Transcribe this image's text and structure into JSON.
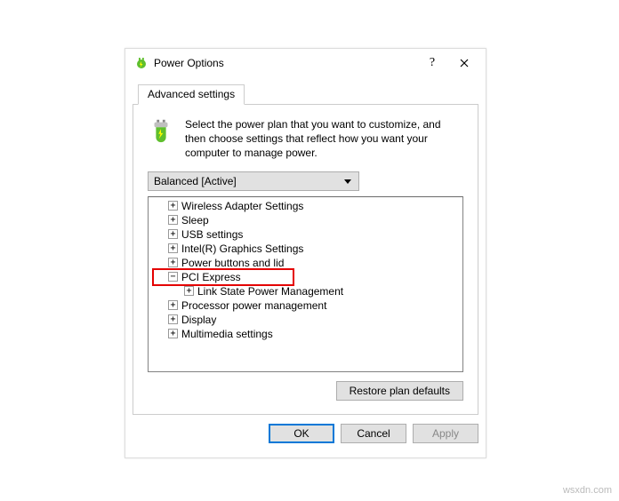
{
  "title": "Power Options",
  "tab": "Advanced settings",
  "description": "Select the power plan that you want to customize, and then choose settings that reflect how you want your computer to manage power.",
  "plan": "Balanced [Active]",
  "tree": [
    {
      "label": "Wireless Adapter Settings",
      "state": "plus",
      "level": 1
    },
    {
      "label": "Sleep",
      "state": "plus",
      "level": 1
    },
    {
      "label": "USB settings",
      "state": "plus",
      "level": 1
    },
    {
      "label": "Intel(R) Graphics Settings",
      "state": "plus",
      "level": 1
    },
    {
      "label": "Power buttons and lid",
      "state": "plus",
      "level": 1
    },
    {
      "label": "PCI Express",
      "state": "minus",
      "level": 1
    },
    {
      "label": "Link State Power Management",
      "state": "plus",
      "level": 2
    },
    {
      "label": "Processor power management",
      "state": "plus",
      "level": 1
    },
    {
      "label": "Display",
      "state": "plus",
      "level": 1
    },
    {
      "label": "Multimedia settings",
      "state": "plus",
      "level": 1
    }
  ],
  "buttons": {
    "restore": "Restore plan defaults",
    "ok": "OK",
    "cancel": "Cancel",
    "apply": "Apply"
  },
  "watermark": "wsxdn.com"
}
